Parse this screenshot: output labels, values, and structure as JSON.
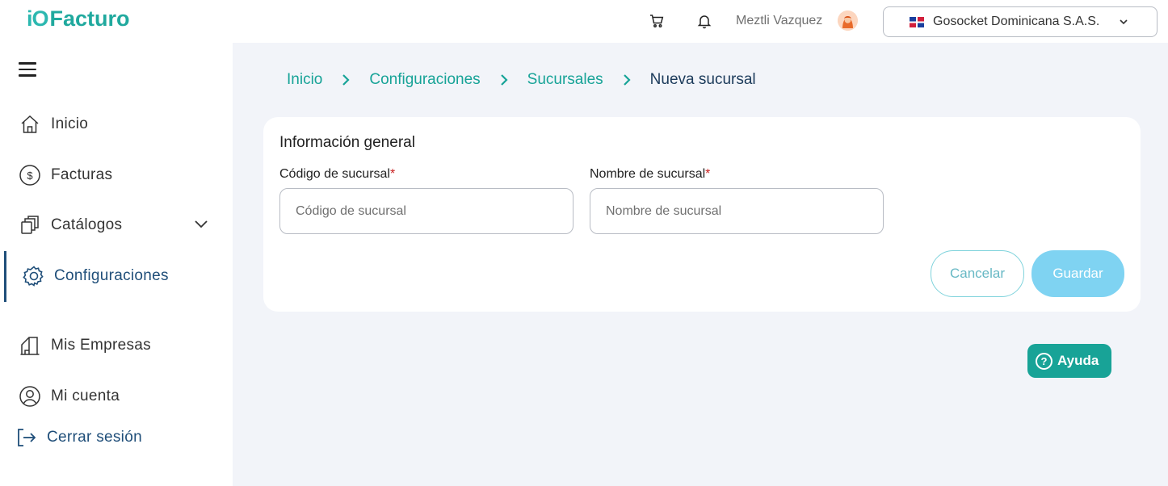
{
  "header": {
    "logo_mark": "iO",
    "logo_text": "Facturo",
    "user_name": "Meztli Vazquez",
    "company": "Gosocket Dominicana S.A.S.",
    "icons": [
      "cart-icon",
      "bell-icon",
      "avatar",
      "dominican-flag-icon",
      "chevron-down-icon"
    ]
  },
  "sidebar": {
    "items": [
      {
        "label": "Inicio",
        "icon": "home-icon"
      },
      {
        "label": "Facturas",
        "icon": "dollar-circle-icon"
      },
      {
        "label": "Catálogos",
        "icon": "catalog-icon"
      },
      {
        "label": "Configuraciones",
        "icon": "gear-icon",
        "active": true
      },
      {
        "label": "Mis Empresas",
        "icon": "building-icon"
      },
      {
        "label": "Mi cuenta",
        "icon": "user-circle-icon"
      },
      {
        "label": "Cerrar sesión",
        "icon": "logout-icon"
      }
    ]
  },
  "breadcrumb": {
    "items": [
      "Inicio",
      "Configuraciones",
      "Sucursales"
    ],
    "current": "Nueva sucursal"
  },
  "form": {
    "title": "Información general",
    "code_label": "Código de sucursal",
    "code_placeholder": "Código de sucursal",
    "name_label": "Nombre de sucursal",
    "name_placeholder": "Nombre de sucursal",
    "required_mark": "*",
    "cancel_label": "Cancelar",
    "save_label": "Guardar"
  },
  "help": {
    "icon_glyph": "?",
    "label": "Ayuda"
  },
  "colors": {
    "brand": "#20a99e",
    "nav_active": "#1f4e79",
    "main_bg": "#f2f4f9",
    "save_button": "#7fd3f2",
    "help_button": "#18a397"
  }
}
